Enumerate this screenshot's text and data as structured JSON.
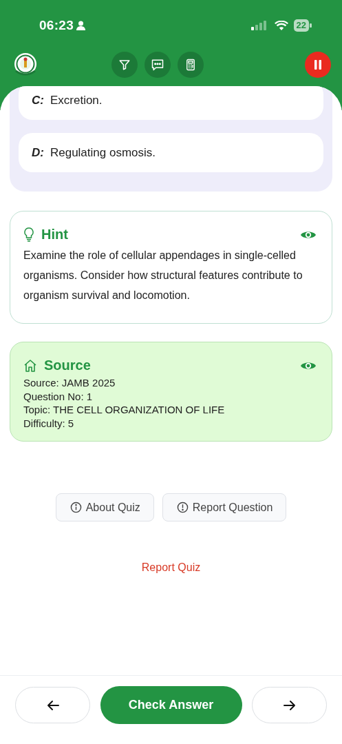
{
  "status_bar": {
    "time": "06:23",
    "battery": "22"
  },
  "options": [
    {
      "letter": "C:",
      "text": "Excretion."
    },
    {
      "letter": "D:",
      "text": "Regulating osmosis."
    }
  ],
  "cards": [
    {
      "kind": "hint",
      "title": "Hint",
      "lines": [
        "Examine the role of cellular appendages in single-celled organisms. Consider how structural features contribute to organism survival and locomotion."
      ]
    },
    {
      "kind": "source",
      "title": "Source",
      "lines": [
        "Source: JAMB 2025",
        "Question No: 1",
        "Topic: THE CELL ORGANIZATION OF LIFE",
        "Difficulty: 5"
      ]
    }
  ],
  "actions": [
    {
      "kind": "info",
      "label": "About Quiz"
    },
    {
      "kind": "alert",
      "label": "Report Question"
    }
  ],
  "report_link": "Report Quiz",
  "nav": {
    "check_label": "Check Answer"
  }
}
